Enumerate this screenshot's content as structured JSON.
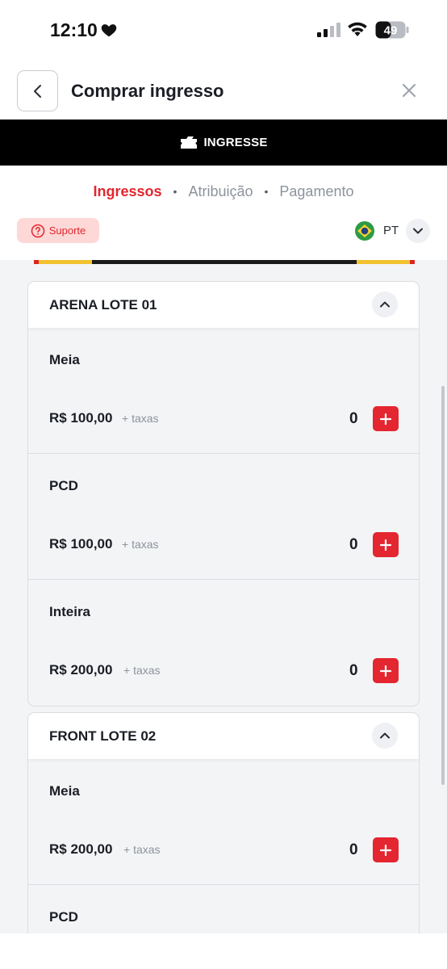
{
  "status_bar": {
    "time": "12:10",
    "battery": "49",
    "icons": [
      "heart-icon",
      "signal-icon",
      "wifi-icon",
      "battery-icon"
    ]
  },
  "header": {
    "title": "Comprar ingresso",
    "icons": [
      "back-arrow-icon",
      "close-icon"
    ]
  },
  "brand": {
    "name": "INGRESSE",
    "background": "#000000"
  },
  "steps": [
    {
      "label": "Ingressos",
      "active": true
    },
    {
      "label": "Atribuição",
      "active": false
    },
    {
      "label": "Pagamento",
      "active": false
    }
  ],
  "step_separator": "•",
  "support": {
    "label": "Suporte",
    "icon": "help-circle-icon"
  },
  "language": {
    "code": "PT",
    "flag": "brazil-flag-icon"
  },
  "lots": [
    {
      "title": "ARENA LOTE 01",
      "tickets": [
        {
          "name": "Meia",
          "price": "R$ 100,00",
          "fee": "+ taxas",
          "quantity": "0"
        },
        {
          "name": "PCD",
          "price": "R$ 100,00",
          "fee": "+ taxas",
          "quantity": "0"
        },
        {
          "name": "Inteira",
          "price": "R$ 200,00",
          "fee": "+ taxas",
          "quantity": "0"
        }
      ]
    },
    {
      "title": "FRONT LOTE 02",
      "tickets": [
        {
          "name": "Meia",
          "price": "R$ 200,00",
          "fee": "+ taxas",
          "quantity": "0"
        },
        {
          "name": "PCD",
          "price": "",
          "fee": "",
          "quantity": ""
        }
      ]
    }
  ],
  "colors": {
    "accent": "#e3262f",
    "support_bg": "#fdd8d6",
    "content_bg": "#f3f4f6",
    "muted_text": "#8d939c"
  }
}
